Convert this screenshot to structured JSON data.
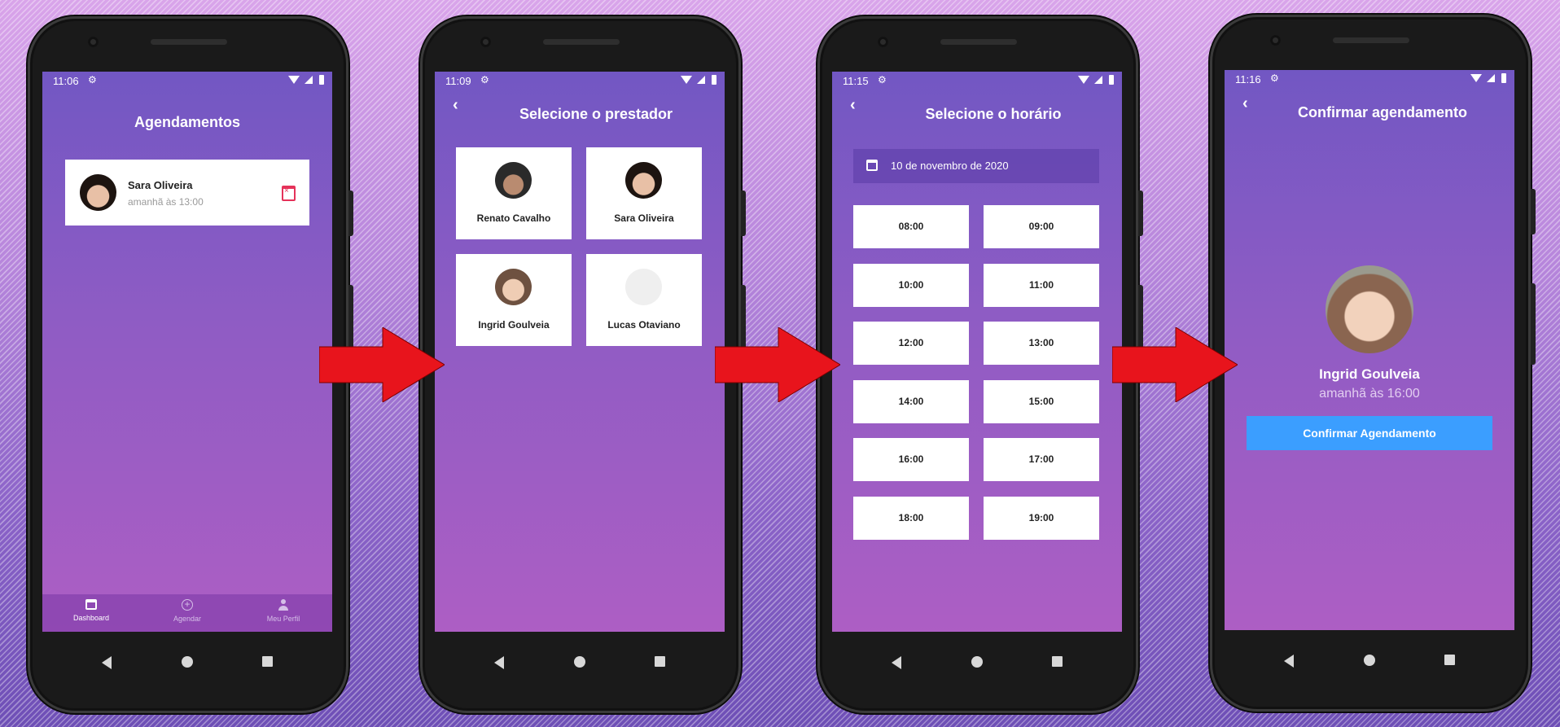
{
  "screens": [
    {
      "status_time": "11:06",
      "title": "Agendamentos",
      "appointment": {
        "name": "Sara Oliveira",
        "time": "amanhã às 13:00"
      },
      "tabs": [
        {
          "label": "Dashboard",
          "icon": "calendar-icon",
          "active": true
        },
        {
          "label": "Agendar",
          "icon": "plus-circle-icon",
          "active": false
        },
        {
          "label": "Meu Perfil",
          "icon": "person-icon",
          "active": false
        }
      ]
    },
    {
      "status_time": "11:09",
      "title": "Selecione o prestador",
      "providers": [
        {
          "name": "Renato Cavalho"
        },
        {
          "name": "Sara Oliveira"
        },
        {
          "name": "Ingrid Goulveia"
        },
        {
          "name": "Lucas Otaviano"
        }
      ]
    },
    {
      "status_time": "11:15",
      "title": "Selecione o horário",
      "date": "10 de novembro de 2020",
      "hours": [
        "08:00",
        "09:00",
        "10:00",
        "11:00",
        "12:00",
        "13:00",
        "14:00",
        "15:00",
        "16:00",
        "17:00",
        "18:00",
        "19:00"
      ]
    },
    {
      "status_time": "11:16",
      "title": "Confirmar agendamento",
      "provider_name": "Ingrid Goulveia",
      "time": "amanhã às 16:00",
      "confirm_label": "Confirmar Agendamento"
    }
  ],
  "colors": {
    "accent": "#3b9eff",
    "cancel_icon": "#e5325a",
    "arrow": "#e8141c"
  }
}
